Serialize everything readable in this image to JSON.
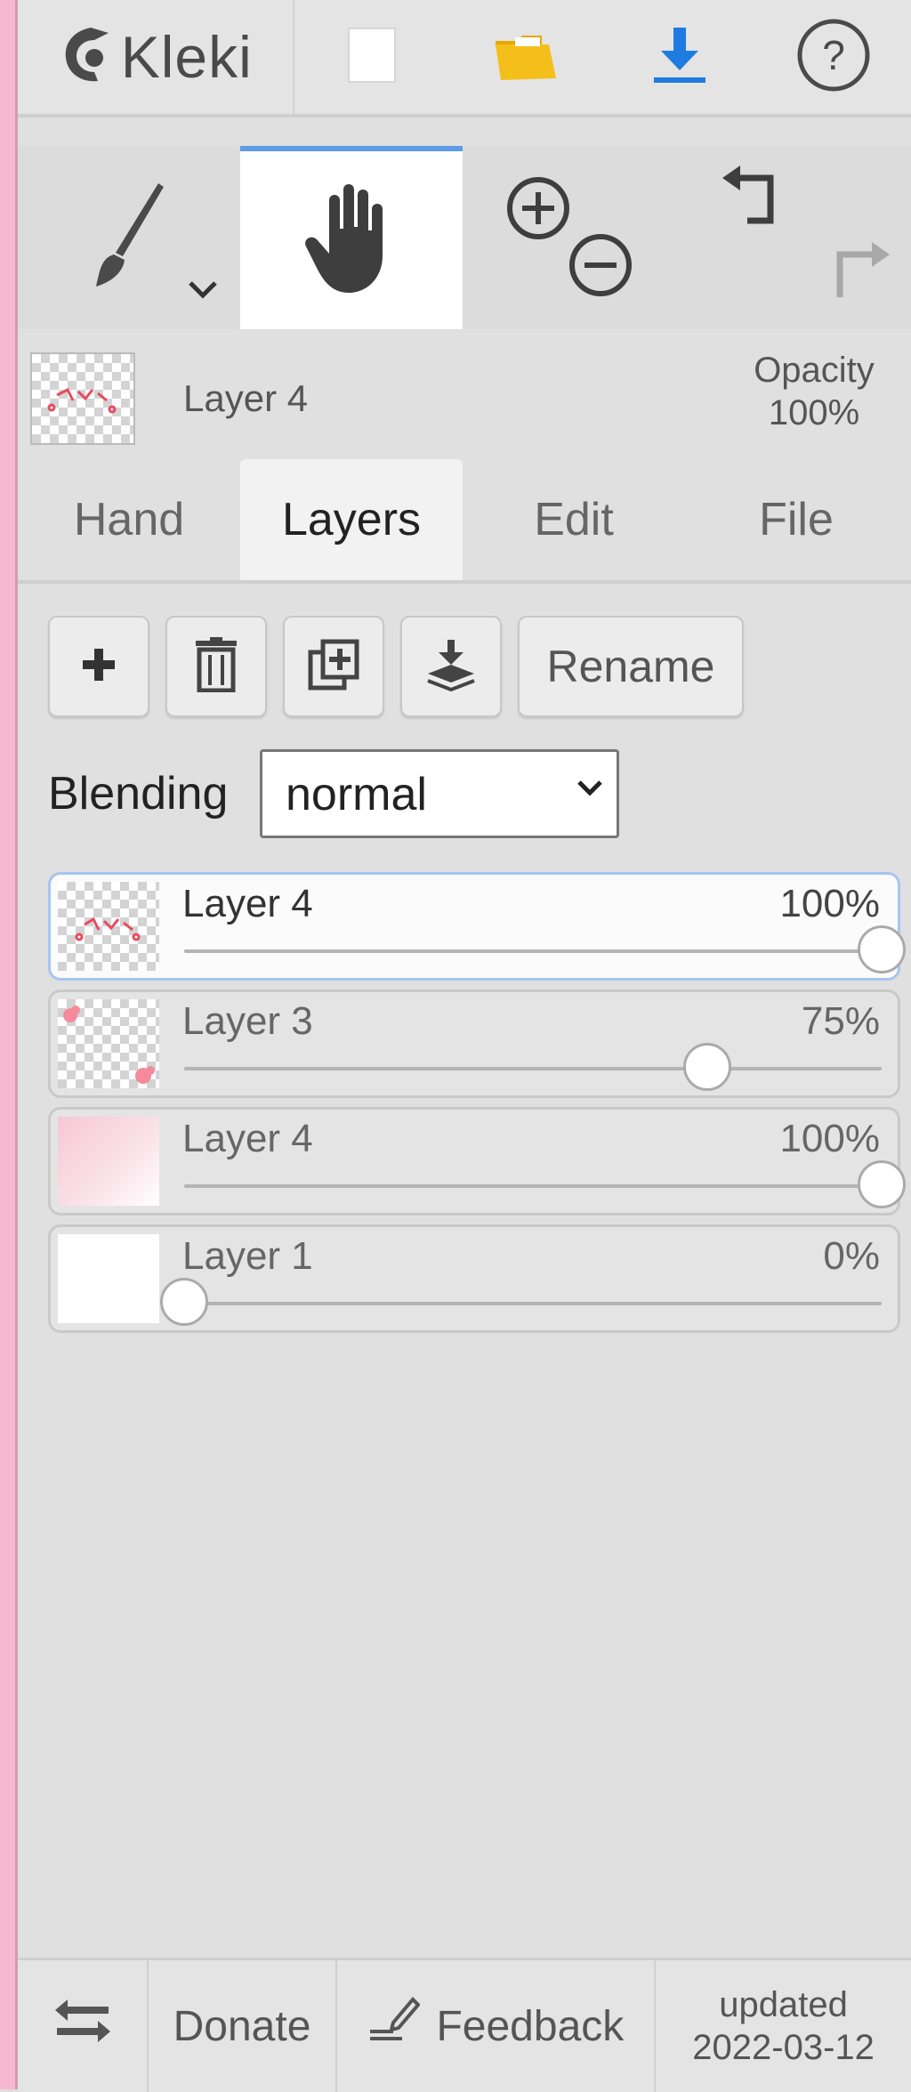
{
  "header": {
    "app_name": "Kleki",
    "icons": [
      "kleki-logo-icon",
      "new-image-icon",
      "open-folder-icon",
      "download-icon",
      "help-icon"
    ]
  },
  "tools": {
    "items": [
      {
        "name": "brush",
        "icon": "brush-icon",
        "active": false
      },
      {
        "name": "hand",
        "icon": "hand-icon",
        "active": true
      },
      {
        "name": "zoom",
        "icon": "zoom-icon",
        "active": false
      },
      {
        "name": "undo-redo",
        "icon": "undo-icon",
        "active": false
      }
    ]
  },
  "current_layer": {
    "name": "Layer 4",
    "opacity_label": "Opacity",
    "opacity_value": "100%"
  },
  "tabs": [
    {
      "label": "Hand",
      "active": false
    },
    {
      "label": "Layers",
      "active": true
    },
    {
      "label": "Edit",
      "active": false
    },
    {
      "label": "File",
      "active": false
    }
  ],
  "layer_actions": {
    "rename_label": "Rename",
    "icons": [
      "add-layer-icon",
      "delete-layer-icon",
      "duplicate-layer-icon",
      "merge-layer-icon"
    ]
  },
  "blending": {
    "label": "Blending",
    "value": "normal"
  },
  "layers": [
    {
      "name": "Layer 4",
      "opacity": "100%",
      "level": 1.0,
      "active": true
    },
    {
      "name": "Layer 3",
      "opacity": "75%",
      "level": 0.75,
      "active": false
    },
    {
      "name": "Layer 4",
      "opacity": "100%",
      "level": 1.0,
      "active": false
    },
    {
      "name": "Layer 1",
      "opacity": "0%",
      "level": 0.0,
      "active": false
    }
  ],
  "footer": {
    "donate_label": "Donate",
    "feedback_label": "Feedback",
    "updated_label": "updated",
    "updated_date": "2022-03-12"
  },
  "colors": {
    "accent": "#5d9be6",
    "download_blue": "#1e7be0",
    "folder_yellow": "#f5bf1b"
  }
}
